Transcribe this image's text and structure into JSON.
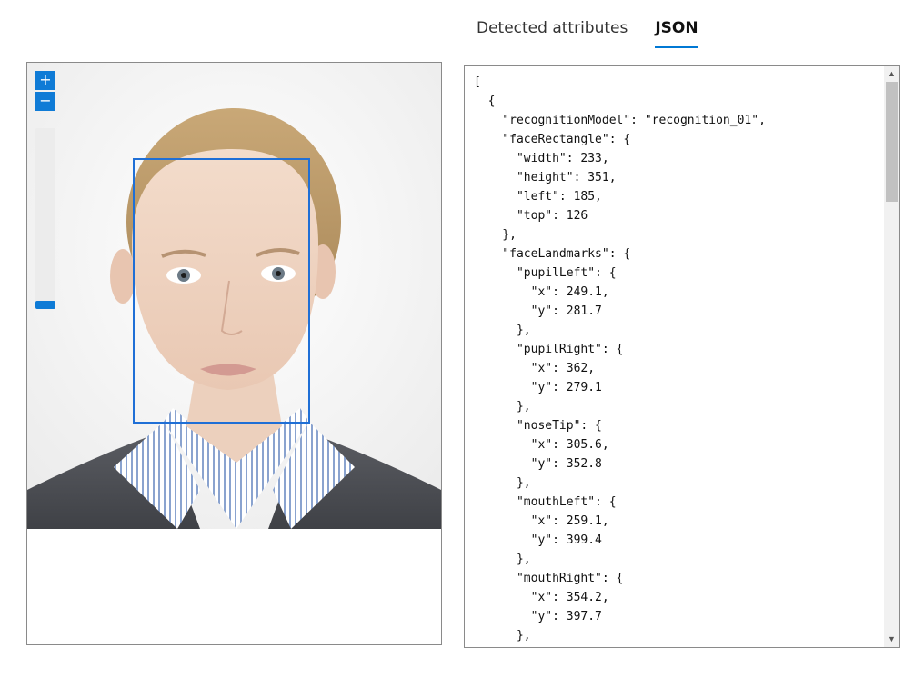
{
  "tabs": [
    {
      "label": "Detected attributes",
      "active": false
    },
    {
      "label": "JSON",
      "active": true
    }
  ],
  "viewer": {
    "zoom_in_label": "+",
    "zoom_out_label": "−",
    "zoom_level": 0
  },
  "json_lines": [
    "[",
    "  {",
    "    \"recognitionModel\": \"recognition_01\",",
    "    \"faceRectangle\": {",
    "      \"width\": 233,",
    "      \"height\": 351,",
    "      \"left\": 185,",
    "      \"top\": 126",
    "    },",
    "    \"faceLandmarks\": {",
    "      \"pupilLeft\": {",
    "        \"x\": 249.1,",
    "        \"y\": 281.7",
    "      },",
    "      \"pupilRight\": {",
    "        \"x\": 362,",
    "        \"y\": 279.1",
    "      },",
    "      \"noseTip\": {",
    "        \"x\": 305.6,",
    "        \"y\": 352.8",
    "      },",
    "      \"mouthLeft\": {",
    "        \"x\": 259.1,",
    "        \"y\": 399.4",
    "      },",
    "      \"mouthRight\": {",
    "        \"x\": 354.2,",
    "        \"y\": 397.7",
    "      },"
  ],
  "colors": {
    "accent": "#0078d4",
    "face_box": "#1f6fd6"
  }
}
